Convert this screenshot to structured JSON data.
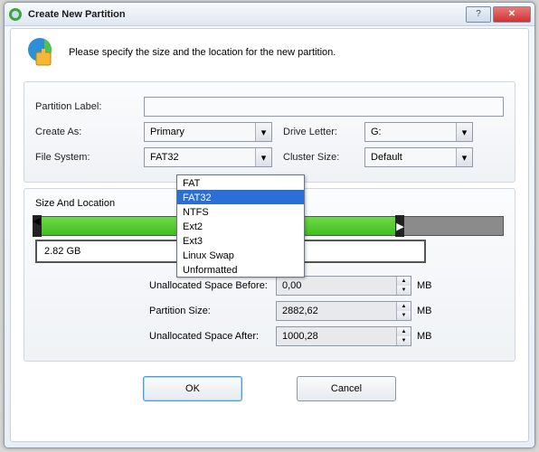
{
  "title": "Create New Partition",
  "intro": "Please specify the size and the location for the new partition.",
  "labels": {
    "partition_label": "Partition Label:",
    "create_as": "Create As:",
    "drive_letter": "Drive Letter:",
    "file_system": "File System:",
    "cluster_size": "Cluster Size:",
    "size_and_location": "Size And Location",
    "space_before": "Unallocated Space Before:",
    "partition_size": "Partition Size:",
    "space_after": "Unallocated Space After:",
    "mb": "MB",
    "ok": "OK",
    "cancel": "Cancel"
  },
  "values": {
    "partition_label": "",
    "create_as": "Primary",
    "drive_letter": "G:",
    "file_system": "FAT32",
    "cluster_size": "Default",
    "disk_size": "2.82 GB",
    "space_before": "0,00",
    "partition_size": "2882,62",
    "space_after": "1000,28"
  },
  "fs_options": [
    "FAT",
    "FAT32",
    "NTFS",
    "Ext2",
    "Ext3",
    "Linux Swap",
    "Unformatted"
  ],
  "fs_selected_index": 1,
  "bar": {
    "green_pct": 78,
    "gray_pct": 22
  }
}
